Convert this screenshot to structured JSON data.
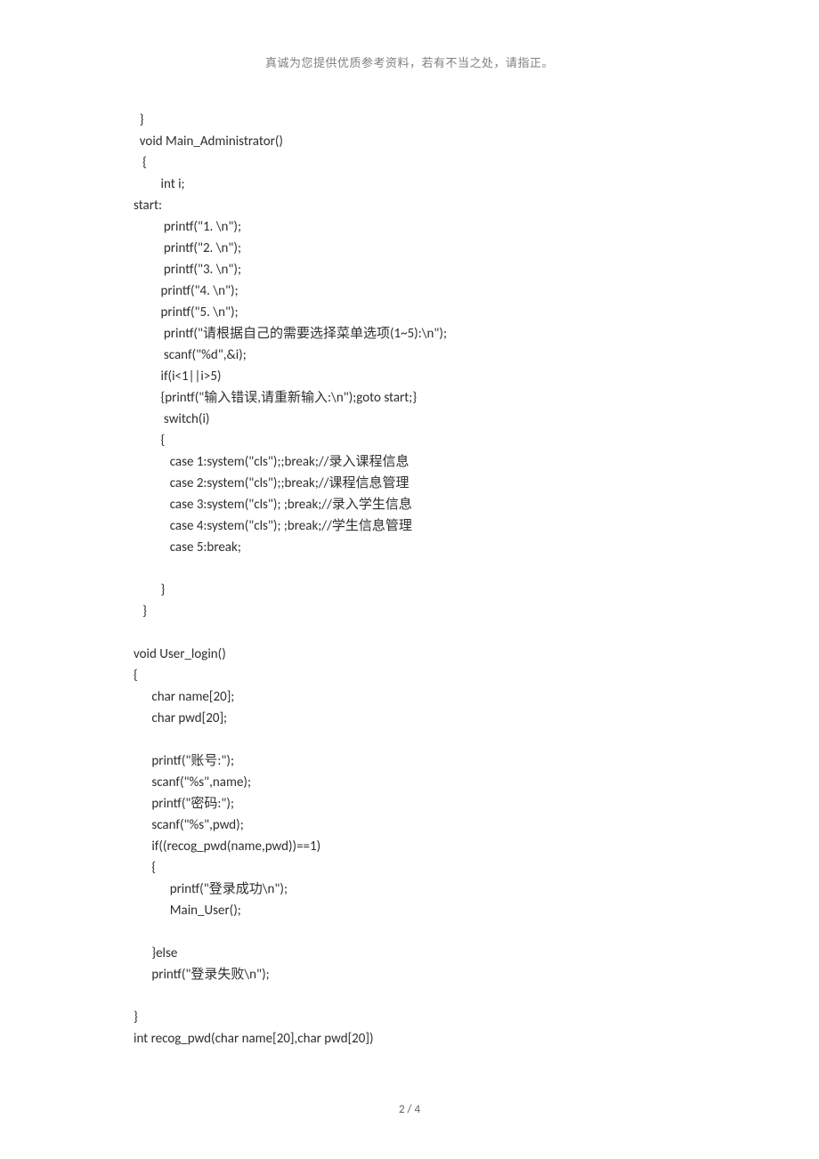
{
  "header": "真诚为您提供优质参考资料，若有不当之处，请指正。",
  "code": "  }\n  void Main_Administrator()\n   {\n         int i;\nstart:\n          printf(\"1. \\n\");\n          printf(\"2. \\n\");\n          printf(\"3. \\n\");\n         printf(\"4. \\n\");\n         printf(\"5. \\n\");\n          printf(\"请根据自己的需要选择菜单选项(1~5):\\n\");\n          scanf(\"%d\",&i);\n         if(i<1||i>5)\n         {printf(\"输入错误,请重新输入:\\n\");goto start;}\n          switch(i)\n         {\n            case 1:system(\"cls\");;break;//录入课程信息\n            case 2:system(\"cls\");;break;//课程信息管理\n            case 3:system(\"cls\"); ;break;//录入学生信息\n            case 4:system(\"cls\"); ;break;//学生信息管理\n            case 5:break;\n\n         }\n   }\n\nvoid User_login()\n{\n      char name[20];\n      char pwd[20];\n\n      printf(\"账号:\");\n      scanf(\"%s\",name);\n      printf(\"密码:\");\n      scanf(\"%s\",pwd);\n      if((recog_pwd(name,pwd))==1)\n      {\n            printf(\"登录成功\\n\");\n            Main_User();\n\n      }else\n      printf(\"登录失败\\n\");\n\n}\nint recog_pwd(char name[20],char pwd[20])",
  "pagenum": "2  /  4"
}
